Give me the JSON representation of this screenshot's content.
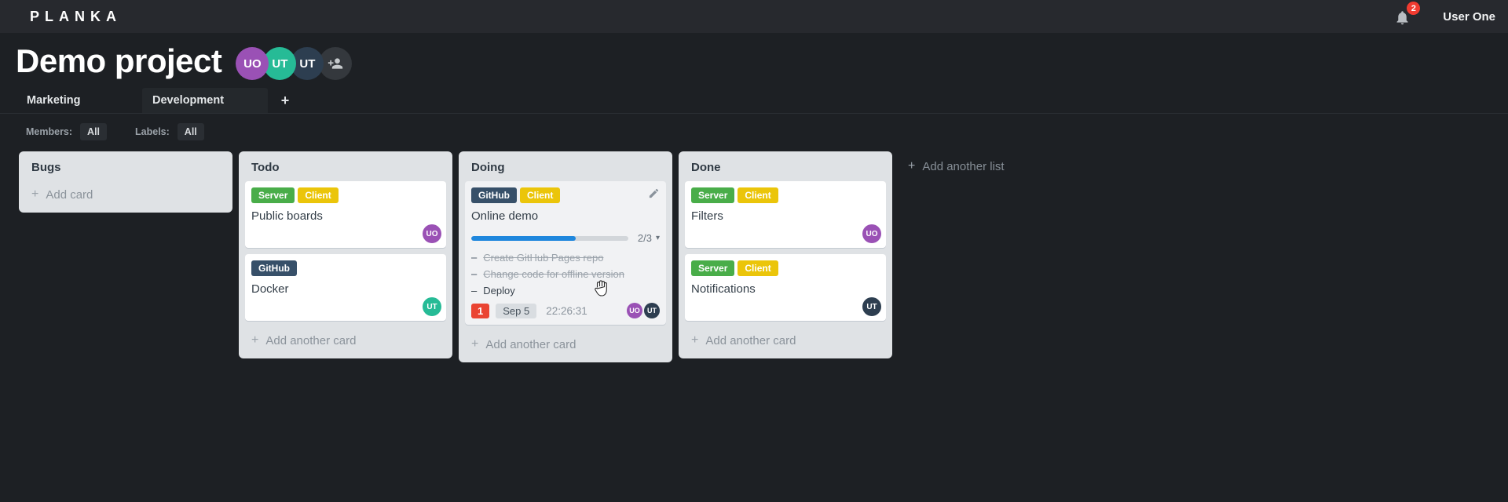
{
  "app": {
    "logo": "PLANKA",
    "user_name": "User One",
    "notifications_count": "2"
  },
  "icons": {
    "plus": "+",
    "chevron_down": "▾",
    "task_dash": "–"
  },
  "colors": {
    "notification_red": "#ea4432",
    "due_badge_bg": "#d9dde1",
    "progress_blue": "#1f87dd"
  },
  "project": {
    "title": "Demo project",
    "members": [
      {
        "initials": "UO",
        "color": "#9a51b5"
      },
      {
        "initials": "UT",
        "color": "#26bb96"
      },
      {
        "initials": "UT",
        "color": "#2d3e50"
      }
    ]
  },
  "tabs": {
    "items": [
      {
        "label": "Marketing"
      },
      {
        "label": "Development"
      }
    ]
  },
  "filters": {
    "members_label": "Members:",
    "members_value": "All",
    "labels_label": "Labels:",
    "labels_value": "All"
  },
  "board": {
    "add_list_label": "Add another list",
    "lists": [
      {
        "title": "Bugs",
        "add_card_label": "Add card",
        "cards": []
      },
      {
        "title": "Todo",
        "add_card_label": "Add another card",
        "cards": [
          {
            "title": "Public boards",
            "labels": [
              {
                "text": "Server",
                "color": "#49ad49"
              },
              {
                "text": "Client",
                "color": "#ebc50a"
              }
            ],
            "members": [
              {
                "initials": "UO",
                "color": "#9a51b5"
              }
            ]
          },
          {
            "title": "Docker",
            "labels": [
              {
                "text": "GitHub",
                "color": "#375069"
              }
            ],
            "members": [
              {
                "initials": "UT",
                "color": "#26bb96"
              }
            ]
          }
        ]
      },
      {
        "title": "Doing",
        "add_card_label": "Add another card",
        "cards": [
          {
            "title": "Online demo",
            "labels": [
              {
                "text": "GitHub",
                "color": "#375069"
              },
              {
                "text": "Client",
                "color": "#ebc50a"
              }
            ],
            "progress": {
              "text": "2/3",
              "percent": 66.7
            },
            "tasks": [
              {
                "text": "Create GitHub Pages repo",
                "done": true
              },
              {
                "text": "Change code for offline version",
                "done": true
              },
              {
                "text": "Deploy",
                "done": false
              }
            ],
            "notification_count": "1",
            "due_date": "Sep 5",
            "timer": "22:26:31",
            "members": [
              {
                "initials": "UO",
                "color": "#9a51b5"
              },
              {
                "initials": "UT",
                "color": "#2d3e50"
              }
            ]
          }
        ]
      },
      {
        "title": "Done",
        "add_card_label": "Add another card",
        "cards": [
          {
            "title": "Filters",
            "labels": [
              {
                "text": "Server",
                "color": "#49ad49"
              },
              {
                "text": "Client",
                "color": "#ebc50a"
              }
            ],
            "members": [
              {
                "initials": "UO",
                "color": "#9a51b5"
              }
            ]
          },
          {
            "title": "Notifications",
            "labels": [
              {
                "text": "Server",
                "color": "#49ad49"
              },
              {
                "text": "Client",
                "color": "#ebc50a"
              }
            ],
            "members": [
              {
                "initials": "UT",
                "color": "#2d3e50"
              }
            ]
          }
        ]
      }
    ]
  }
}
